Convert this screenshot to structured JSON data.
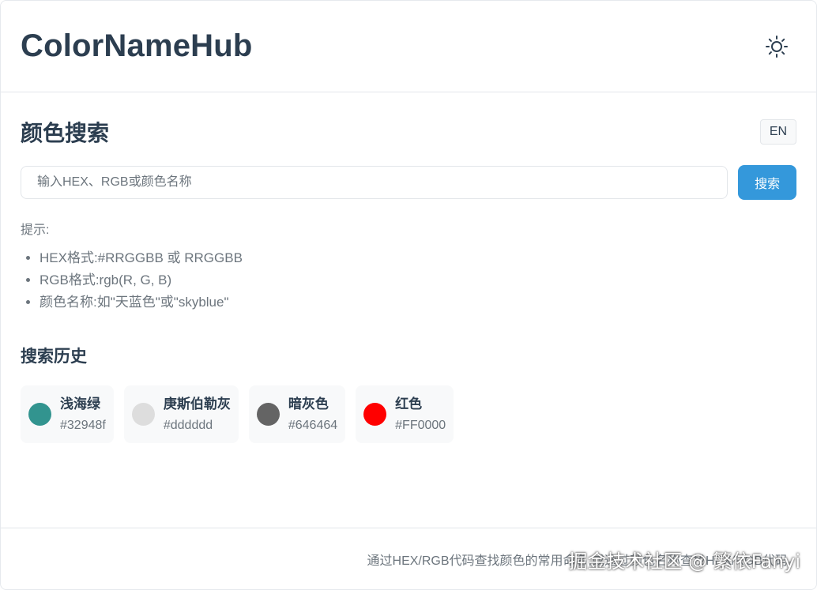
{
  "header": {
    "title": "ColorNameHub",
    "theme_toggle_icon": "sun-icon"
  },
  "search": {
    "title": "颜色搜索",
    "lang_button": "EN",
    "placeholder": "输入HEX、RGB或颜色名称",
    "value": "",
    "button_label": "搜索"
  },
  "tips": {
    "label": "提示:",
    "items": [
      "HEX格式:#RRGGBB 或 RRGGBB",
      "RGB格式:rgb(R, G, B)",
      "颜色名称:如\"天蓝色\"或\"skyblue\""
    ]
  },
  "history": {
    "title": "搜索历史",
    "items": [
      {
        "name": "浅海绿",
        "hex": "#32948f",
        "color": "#32948f"
      },
      {
        "name": "庚斯伯勒灰",
        "hex": "#dddddd",
        "color": "#dddddd"
      },
      {
        "name": "暗灰色",
        "hex": "#646464",
        "color": "#646464"
      },
      {
        "name": "红色",
        "hex": "#FF0000",
        "color": "#FF0000"
      }
    ]
  },
  "footer": {
    "text": "通过HEX/RGB代码查找颜色的常用命名,或通过颜色名称查找HEX/RGB代码。"
  },
  "watermark": "掘金技术社区 @ 繁依Fanyi",
  "colors": {
    "accent": "#3498db",
    "text_dark": "#2c3e50",
    "text_muted": "#6c757d",
    "card_bg": "#f8f9fa"
  }
}
